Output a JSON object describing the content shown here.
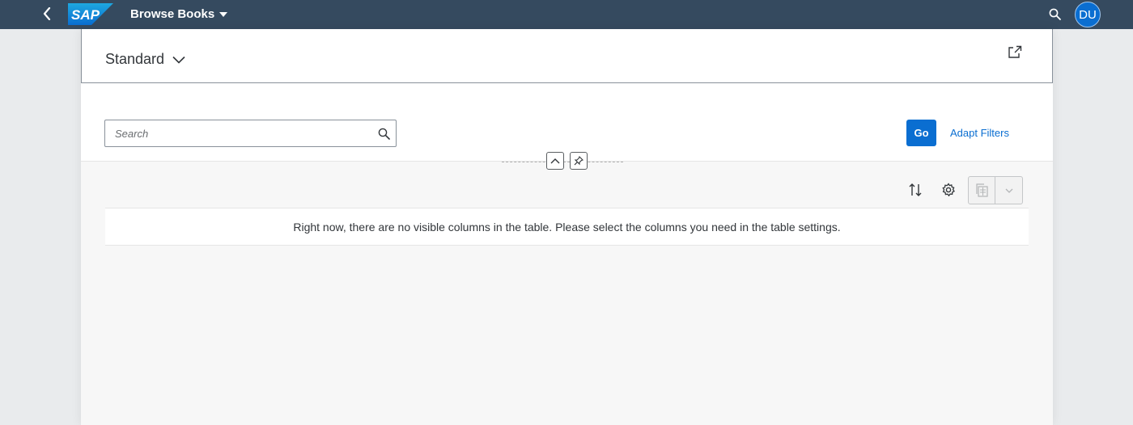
{
  "shell": {
    "title": "Browse Books",
    "logo_text": "SAP",
    "avatar_initials": "DU",
    "colors": {
      "bar": "#354a5f",
      "avatar": "#0a6ed1"
    },
    "icons": [
      "back-arrow-icon",
      "search-icon"
    ]
  },
  "header": {
    "variant_label": "Standard",
    "icons": [
      "chevron-down-icon",
      "share-icon"
    ]
  },
  "filterbar": {
    "search_placeholder": "Search",
    "go_label": "Go",
    "adapt_filters_label": "Adapt Filters",
    "colors": {
      "emphasized": "#0a6ed1"
    }
  },
  "table": {
    "no_data_text": "Right now, there are no visible columns in the table. Please select the columns you need in the table settings.",
    "toolbar_icons": [
      "sort-icon",
      "settings-icon",
      "export-icon",
      "chevron-down-icon"
    ]
  }
}
